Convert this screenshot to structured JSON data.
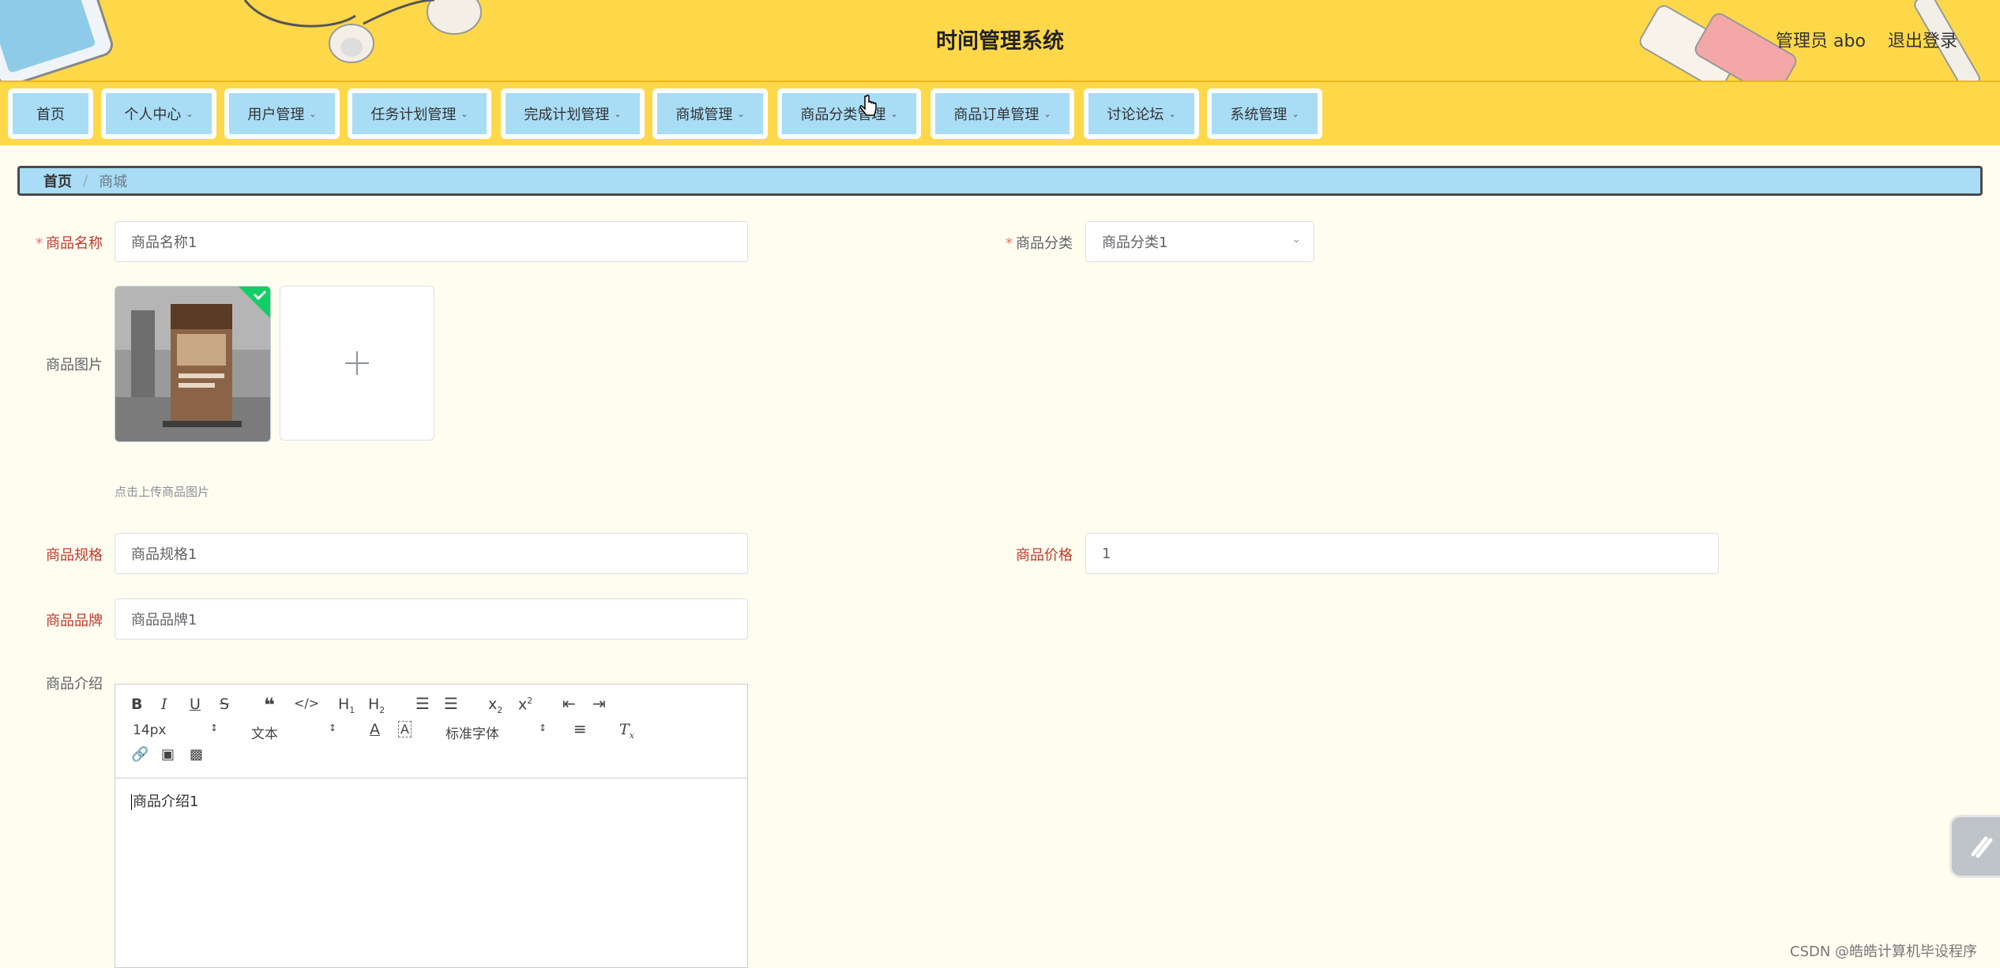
{
  "header": {
    "title": "时间管理系统",
    "user": "管理员 abo",
    "logout": "退出登录"
  },
  "nav": [
    {
      "label": "首页",
      "dropdown": false
    },
    {
      "label": "个人中心",
      "dropdown": true
    },
    {
      "label": "用户管理",
      "dropdown": true
    },
    {
      "label": "任务计划管理",
      "dropdown": true
    },
    {
      "label": "完成计划管理",
      "dropdown": true
    },
    {
      "label": "商城管理",
      "dropdown": true
    },
    {
      "label": "商品分类管理",
      "dropdown": true
    },
    {
      "label": "商品订单管理",
      "dropdown": true
    },
    {
      "label": "讨论论坛",
      "dropdown": true
    },
    {
      "label": "系统管理",
      "dropdown": true
    }
  ],
  "breadcrumb": {
    "home": "首页",
    "separator": "/",
    "current": "商城"
  },
  "form": {
    "name": {
      "label": "商品名称",
      "value": "商品名称1",
      "required": true
    },
    "category": {
      "label": "商品分类",
      "value": "商品分类1",
      "required": true
    },
    "image": {
      "label": "商品图片",
      "tip": "点击上传商品图片"
    },
    "spec": {
      "label": "商品规格",
      "value": "商品规格1"
    },
    "price": {
      "label": "商品价格",
      "value": "1"
    },
    "brand": {
      "label": "商品品牌",
      "value": "商品品牌1"
    },
    "intro": {
      "label": "商品介绍",
      "value": "商品介绍1"
    }
  },
  "editor": {
    "font_size": "14px",
    "header_select": "文本",
    "font_family": "标准字体"
  },
  "watermark": "CSDN @皓皓计算机毕设程序",
  "colors": {
    "header_bg": "#ffd84a",
    "nav_item_bg": "#a9dcf5",
    "page_bg": "#fffdf0",
    "required_label": "#c0392b"
  }
}
